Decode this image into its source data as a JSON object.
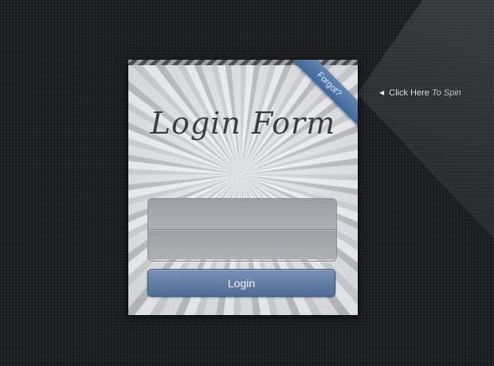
{
  "form": {
    "title": "Login Form",
    "ribbon_label": "Forgot?",
    "fields": [
      {
        "value": "",
        "placeholder": ""
      },
      {
        "value": "",
        "placeholder": ""
      }
    ],
    "login_label": "Login"
  },
  "spin_hint": {
    "icon": "triangle-left-icon",
    "label": "Click Here",
    "emphasis": "To Spin"
  },
  "colors": {
    "background": "#1e1f21",
    "button": "#5e7aa3",
    "ribbon": "#4d71a4",
    "title": "#3b3c3e"
  }
}
